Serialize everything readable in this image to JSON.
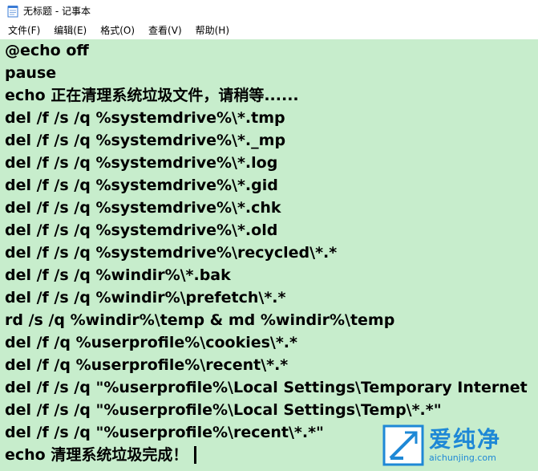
{
  "window": {
    "title": "无标题 - 记事本",
    "icon": "notepad-icon"
  },
  "menu": {
    "items": [
      {
        "label": "文件(F)"
      },
      {
        "label": "编辑(E)"
      },
      {
        "label": "格式(O)"
      },
      {
        "label": "查看(V)"
      },
      {
        "label": "帮助(H)"
      }
    ]
  },
  "editor": {
    "background": "#c7edcc",
    "lines": [
      "@echo off",
      "pause",
      "echo 正在清理系统垃圾文件，请稍等......",
      "del /f /s /q %systemdrive%\\*.tmp",
      "del /f /s /q %systemdrive%\\*._mp",
      "del /f /s /q %systemdrive%\\*.log",
      "del /f /s /q %systemdrive%\\*.gid",
      "del /f /s /q %systemdrive%\\*.chk",
      "del /f /s /q %systemdrive%\\*.old",
      "del /f /s /q %systemdrive%\\recycled\\*.*",
      "del /f /s /q %windir%\\*.bak",
      "del /f /s /q %windir%\\prefetch\\*.*",
      "rd /s /q %windir%\\temp & md %windir%\\temp",
      "del /f /q %userprofile%\\cookies\\*.*",
      "del /f /q %userprofile%\\recent\\*.*",
      "del /f /s /q \"%userprofile%\\Local Settings\\Temporary Internet",
      "del /f /s /q \"%userprofile%\\Local Settings\\Temp\\*.*\"",
      "del /f /s /q \"%userprofile%\\recent\\*.*\"",
      "echo 清理系统垃圾完成！"
    ]
  },
  "watermark": {
    "brand": "爱纯净",
    "url": "aichunjing.com",
    "color": "#1e88d6"
  }
}
